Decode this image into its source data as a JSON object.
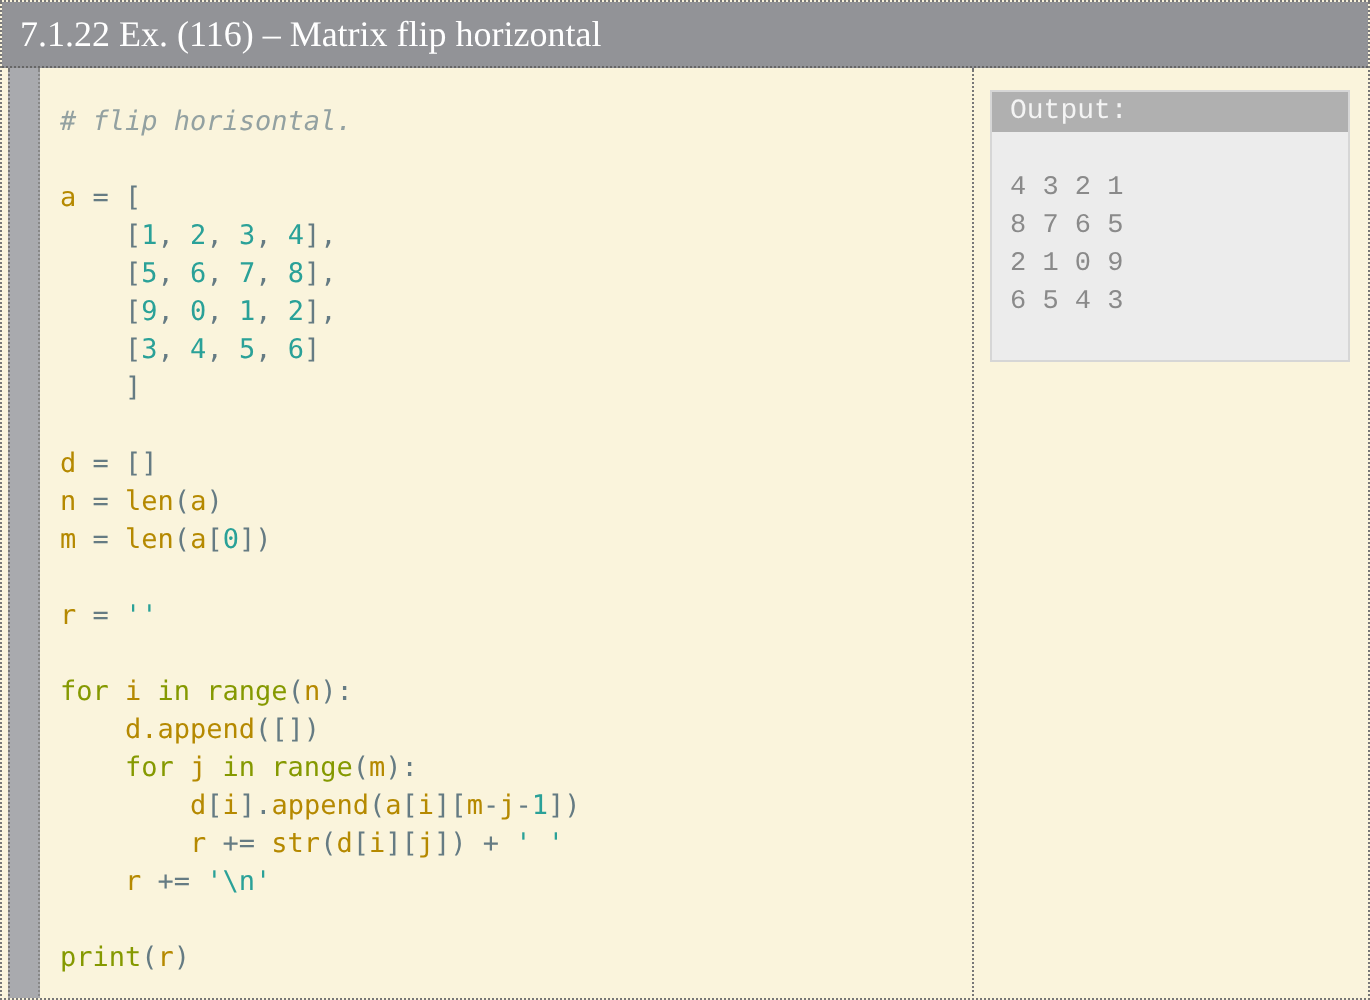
{
  "title": "7.1.22 Ex. (116) – Matrix flip horizontal",
  "code_blocks": [
    [
      [
        {
          "text": "# flip horisontal.",
          "kind": "comment"
        }
      ]
    ],
    [
      [
        {
          "text": "a",
          "kind": "name"
        },
        {
          "text": " = [",
          "kind": "punct"
        }
      ],
      [
        {
          "text": "    [",
          "kind": "punct"
        },
        {
          "text": "1",
          "kind": "literal"
        },
        {
          "text": ", ",
          "kind": "punct"
        },
        {
          "text": "2",
          "kind": "literal"
        },
        {
          "text": ", ",
          "kind": "punct"
        },
        {
          "text": "3",
          "kind": "literal"
        },
        {
          "text": ", ",
          "kind": "punct"
        },
        {
          "text": "4",
          "kind": "literal"
        },
        {
          "text": "],",
          "kind": "punct"
        }
      ],
      [
        {
          "text": "    [",
          "kind": "punct"
        },
        {
          "text": "5",
          "kind": "literal"
        },
        {
          "text": ", ",
          "kind": "punct"
        },
        {
          "text": "6",
          "kind": "literal"
        },
        {
          "text": ", ",
          "kind": "punct"
        },
        {
          "text": "7",
          "kind": "literal"
        },
        {
          "text": ", ",
          "kind": "punct"
        },
        {
          "text": "8",
          "kind": "literal"
        },
        {
          "text": "],",
          "kind": "punct"
        }
      ],
      [
        {
          "text": "    [",
          "kind": "punct"
        },
        {
          "text": "9",
          "kind": "literal"
        },
        {
          "text": ", ",
          "kind": "punct"
        },
        {
          "text": "0",
          "kind": "literal"
        },
        {
          "text": ", ",
          "kind": "punct"
        },
        {
          "text": "1",
          "kind": "literal"
        },
        {
          "text": ", ",
          "kind": "punct"
        },
        {
          "text": "2",
          "kind": "literal"
        },
        {
          "text": "],",
          "kind": "punct"
        }
      ],
      [
        {
          "text": "    [",
          "kind": "punct"
        },
        {
          "text": "3",
          "kind": "literal"
        },
        {
          "text": ", ",
          "kind": "punct"
        },
        {
          "text": "4",
          "kind": "literal"
        },
        {
          "text": ", ",
          "kind": "punct"
        },
        {
          "text": "5",
          "kind": "literal"
        },
        {
          "text": ", ",
          "kind": "punct"
        },
        {
          "text": "6",
          "kind": "literal"
        },
        {
          "text": "]",
          "kind": "punct"
        }
      ],
      [
        {
          "text": "    ]",
          "kind": "punct"
        }
      ]
    ],
    [
      [
        {
          "text": "d",
          "kind": "name"
        },
        {
          "text": " = []",
          "kind": "punct"
        }
      ],
      [
        {
          "text": "n",
          "kind": "name"
        },
        {
          "text": " = ",
          "kind": "punct"
        },
        {
          "text": "len",
          "kind": "name"
        },
        {
          "text": "(",
          "kind": "punct"
        },
        {
          "text": "a",
          "kind": "name"
        },
        {
          "text": ")",
          "kind": "punct"
        }
      ],
      [
        {
          "text": "m",
          "kind": "name"
        },
        {
          "text": " = ",
          "kind": "punct"
        },
        {
          "text": "len",
          "kind": "name"
        },
        {
          "text": "(",
          "kind": "punct"
        },
        {
          "text": "a",
          "kind": "name"
        },
        {
          "text": "[",
          "kind": "punct"
        },
        {
          "text": "0",
          "kind": "literal"
        },
        {
          "text": "])",
          "kind": "punct"
        }
      ]
    ],
    [
      [
        {
          "text": "r",
          "kind": "name"
        },
        {
          "text": " = ",
          "kind": "punct"
        },
        {
          "text": "''",
          "kind": "literal"
        }
      ]
    ],
    [
      [
        {
          "text": "for ",
          "kind": "keyword"
        },
        {
          "text": "i ",
          "kind": "name"
        },
        {
          "text": "in range",
          "kind": "keyword"
        },
        {
          "text": "(",
          "kind": "punct"
        },
        {
          "text": "n",
          "kind": "name"
        },
        {
          "text": "):",
          "kind": "punct"
        }
      ],
      [
        {
          "text": "    d.append",
          "kind": "name"
        },
        {
          "text": "([])",
          "kind": "punct"
        }
      ],
      [
        {
          "text": "    for ",
          "kind": "keyword"
        },
        {
          "text": "j ",
          "kind": "name"
        },
        {
          "text": "in range",
          "kind": "keyword"
        },
        {
          "text": "(",
          "kind": "punct"
        },
        {
          "text": "m",
          "kind": "name"
        },
        {
          "text": "):",
          "kind": "punct"
        }
      ],
      [
        {
          "text": "        d",
          "kind": "name"
        },
        {
          "text": "[",
          "kind": "punct"
        },
        {
          "text": "i",
          "kind": "name"
        },
        {
          "text": "].",
          "kind": "punct"
        },
        {
          "text": "append",
          "kind": "name"
        },
        {
          "text": "(",
          "kind": "punct"
        },
        {
          "text": "a",
          "kind": "name"
        },
        {
          "text": "[",
          "kind": "punct"
        },
        {
          "text": "i",
          "kind": "name"
        },
        {
          "text": "][",
          "kind": "punct"
        },
        {
          "text": "m",
          "kind": "name"
        },
        {
          "text": "-",
          "kind": "punct"
        },
        {
          "text": "j",
          "kind": "name"
        },
        {
          "text": "-",
          "kind": "punct"
        },
        {
          "text": "1",
          "kind": "literal"
        },
        {
          "text": "])",
          "kind": "punct"
        }
      ],
      [
        {
          "text": "        r",
          "kind": "name"
        },
        {
          "text": " += ",
          "kind": "punct"
        },
        {
          "text": "str",
          "kind": "name"
        },
        {
          "text": "(",
          "kind": "punct"
        },
        {
          "text": "d",
          "kind": "name"
        },
        {
          "text": "[",
          "kind": "punct"
        },
        {
          "text": "i",
          "kind": "name"
        },
        {
          "text": "][",
          "kind": "punct"
        },
        {
          "text": "j",
          "kind": "name"
        },
        {
          "text": "]) + ",
          "kind": "punct"
        },
        {
          "text": "' '",
          "kind": "literal"
        }
      ],
      [
        {
          "text": "    r",
          "kind": "name"
        },
        {
          "text": " += ",
          "kind": "punct"
        },
        {
          "text": "'\\n'",
          "kind": "literal"
        }
      ]
    ],
    [
      [
        {
          "text": "print",
          "kind": "keyword"
        },
        {
          "text": "(",
          "kind": "punct"
        },
        {
          "text": "r",
          "kind": "name"
        },
        {
          "text": ")",
          "kind": "punct"
        }
      ]
    ]
  ],
  "output": {
    "label": "Output:",
    "lines": [
      "4 3 2 1",
      "8 7 6 5",
      "2 1 0 9",
      "6 5 4 3"
    ]
  }
}
